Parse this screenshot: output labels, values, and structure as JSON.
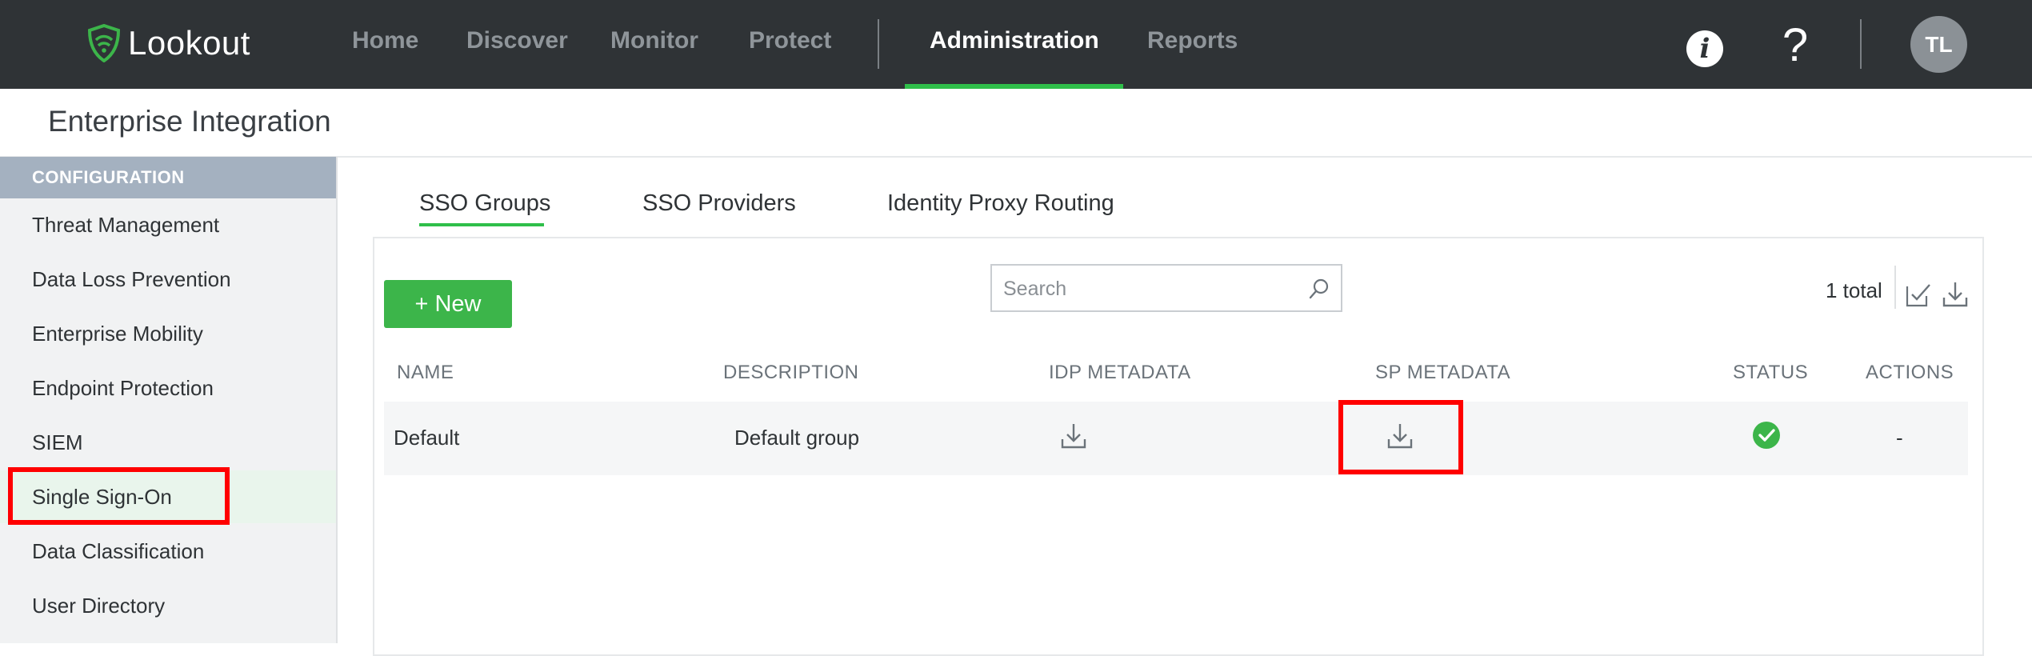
{
  "app": {
    "logo_text": "Lookout"
  },
  "nav": {
    "items": [
      {
        "label": "Home"
      },
      {
        "label": "Discover"
      },
      {
        "label": "Monitor"
      },
      {
        "label": "Protect"
      },
      {
        "label": "Administration",
        "active": true
      },
      {
        "label": "Reports"
      }
    ]
  },
  "header": {
    "info_icon": "info-icon",
    "help_icon": "help-icon",
    "avatar_initials": "TL"
  },
  "page": {
    "title": "Enterprise Integration"
  },
  "sidebar": {
    "section_header": "CONFIGURATION",
    "items": [
      {
        "label": "Threat Management"
      },
      {
        "label": "Data Loss Prevention"
      },
      {
        "label": "Enterprise Mobility"
      },
      {
        "label": "Endpoint Protection"
      },
      {
        "label": "SIEM"
      },
      {
        "label": "Single Sign-On",
        "active": true
      },
      {
        "label": "Data Classification"
      },
      {
        "label": "User Directory"
      }
    ]
  },
  "tabs": [
    {
      "label": "SSO Groups",
      "active": true
    },
    {
      "label": "SSO Providers"
    },
    {
      "label": "Identity Proxy Routing"
    }
  ],
  "toolbar": {
    "new_label": "+ New",
    "search_placeholder": "Search",
    "total_text": "1 total"
  },
  "table": {
    "columns": [
      "NAME",
      "DESCRIPTION",
      "IDP METADATA",
      "SP METADATA",
      "STATUS",
      "ACTIONS"
    ],
    "rows": [
      {
        "name": "Default",
        "description": "Default group",
        "idp_metadata": "download-icon",
        "sp_metadata": "download-icon",
        "status": "check-circle-icon",
        "actions": "-"
      }
    ]
  },
  "colors": {
    "accent": "#2fbf4a",
    "topbar": "#2f3336",
    "highlight": "#ff0000",
    "button": "#3cb54a"
  }
}
